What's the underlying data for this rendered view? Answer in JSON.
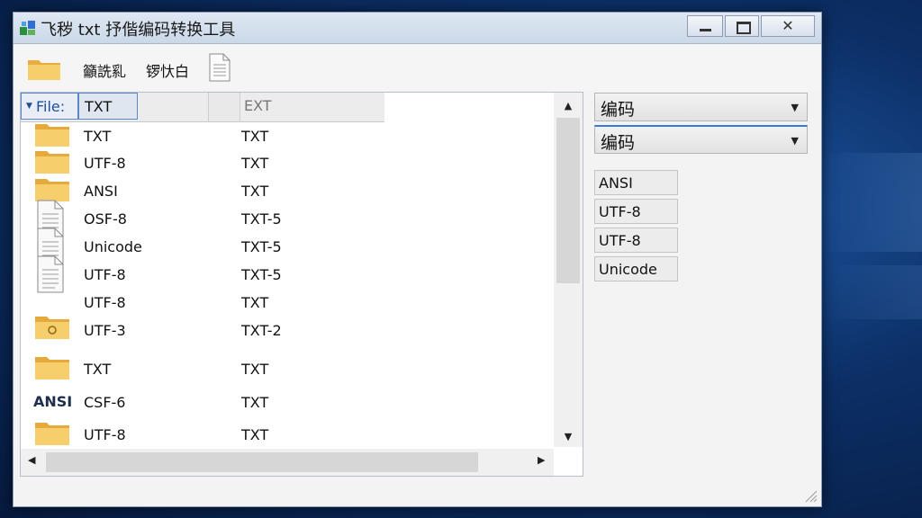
{
  "window": {
    "title": "飞秽 txt 抒偕编码转换工具",
    "close_glyph": "✕"
  },
  "toolbar": {
    "label_1": "籲詵乿",
    "label_2": "锣忕白"
  },
  "list": {
    "header": {
      "file_label": "File:",
      "col1": "TXT",
      "col2": "EXT"
    },
    "rows": [
      {
        "icon": "folder-icon",
        "name": "TXT",
        "ext": "TXT"
      },
      {
        "icon": "folder-icon",
        "name": "UTF-8",
        "ext": "TXT"
      },
      {
        "icon": "folder-icon",
        "name": "ANSI",
        "ext": "TXT"
      },
      {
        "icon": "document-icon",
        "name": "OSF-8",
        "ext": "TXT-5"
      },
      {
        "icon": "document-icon",
        "name": "Unicode",
        "ext": "TXT-5"
      },
      {
        "icon": "document-icon",
        "name": "UTF-8",
        "ext": "TXT-5"
      },
      {
        "icon": "none",
        "name": "UTF-8",
        "ext": "TXT"
      },
      {
        "icon": "folder-open-icon",
        "name": "UTF-3",
        "ext": "TXT-2"
      },
      {
        "icon": "folder-icon",
        "name": "TXT",
        "ext": "TXT"
      },
      {
        "icon": "ansi-text-icon",
        "badge": "ANSI",
        "name": "CSF-6",
        "ext": "TXT"
      },
      {
        "icon": "folder-icon",
        "name": "UTF-8",
        "ext": "TXT"
      }
    ]
  },
  "encoding_panel": {
    "combo_1": "编码",
    "combo_2": "编码",
    "options": [
      "ANSI",
      "UTF-8",
      "UTF-8",
      "Unicode"
    ]
  },
  "colors": {
    "title_bar": "#cbd8e8",
    "selection_border": "#5b86c7",
    "accent_line": "#3a78d6",
    "folder": "#f0c15a",
    "desktop": "#0c2f66"
  }
}
